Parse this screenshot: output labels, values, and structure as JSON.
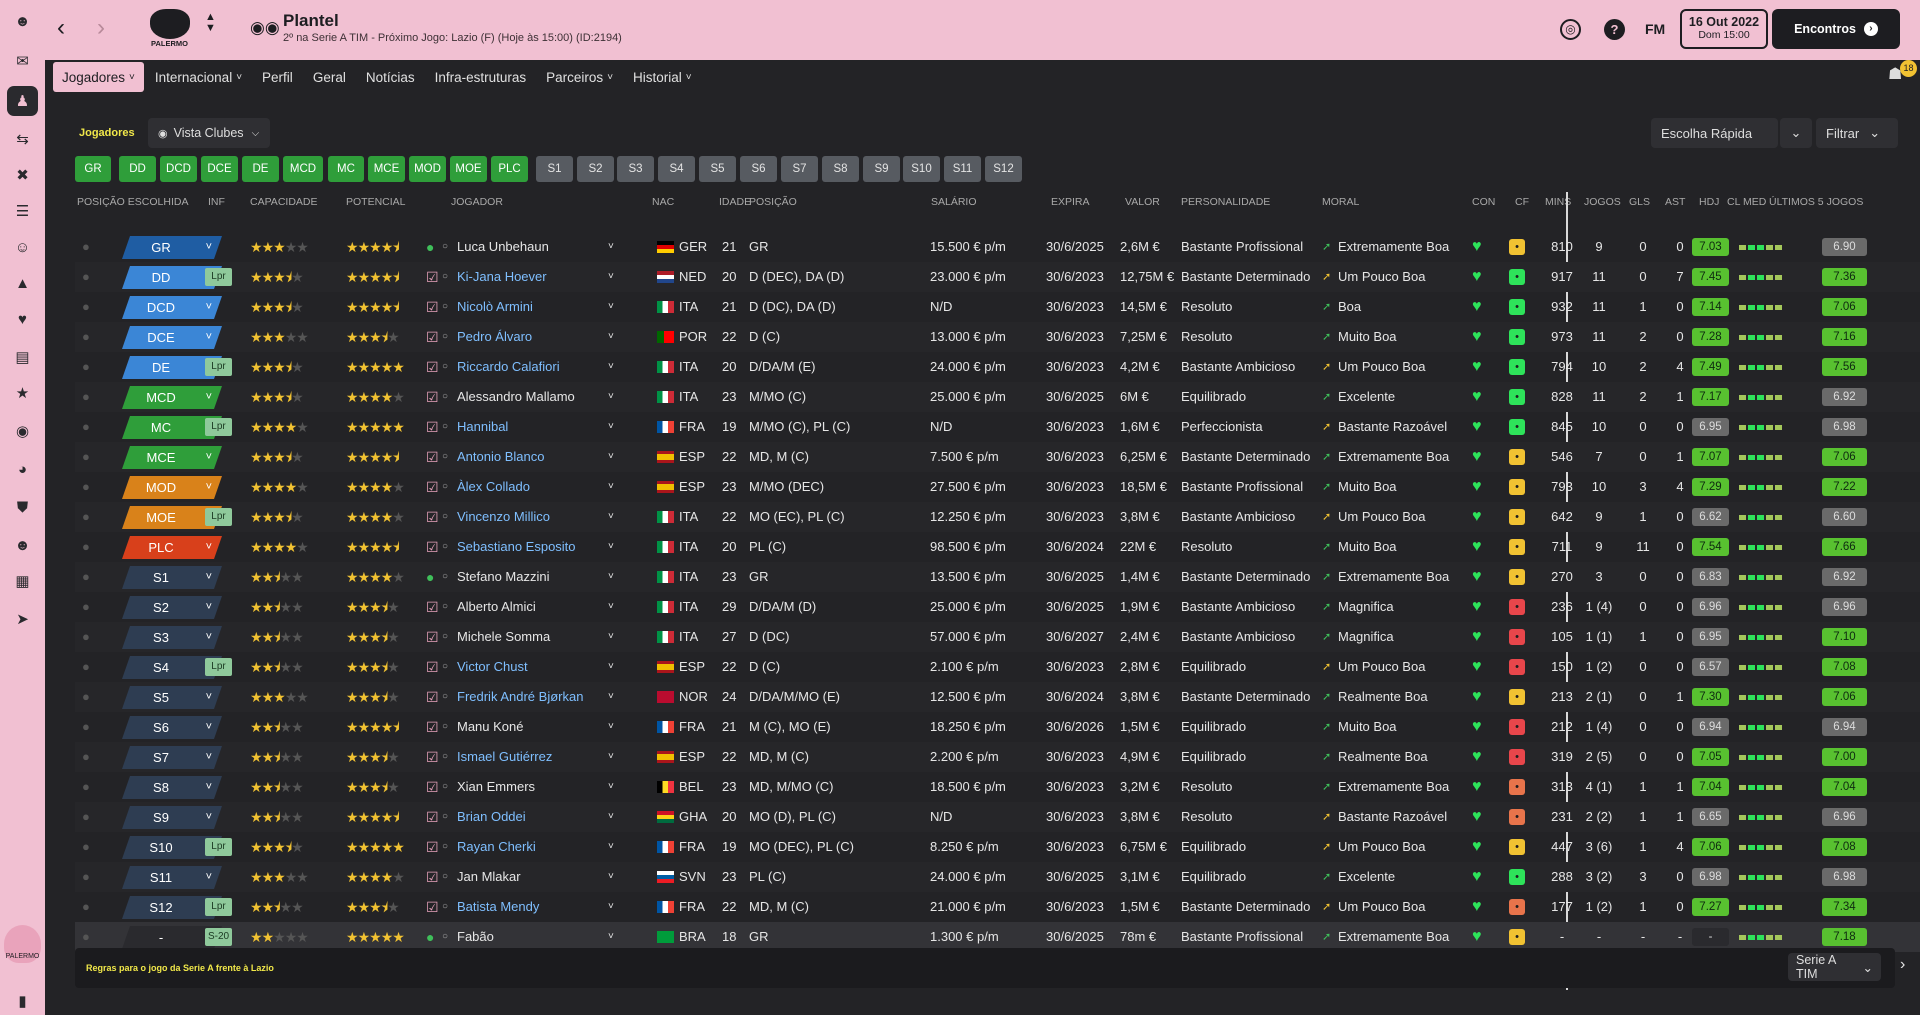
{
  "header": {
    "title": "Plantel",
    "subtitle": "2º na Serie A TIM - Próximo Jogo: Lazio (F) (Hoje às 15:00) (ID:2194)",
    "club": "PALERMO",
    "date": "16 Out 2022",
    "time": "Dom 15:00",
    "continue_label": "Encontros",
    "fm": "FM",
    "notif_count": "18"
  },
  "tabs": [
    {
      "label": "Jogadores",
      "active": true,
      "dd": true
    },
    {
      "label": "Internacional",
      "dd": true
    },
    {
      "label": "Perfil"
    },
    {
      "label": "Geral"
    },
    {
      "label": "Notícias"
    },
    {
      "label": "Infra-estruturas"
    },
    {
      "label": "Parceiros",
      "dd": true
    },
    {
      "label": "Historial",
      "dd": true
    }
  ],
  "toolbar": {
    "section": "Jogadores",
    "view": "Vista Clubes",
    "quick": "Escolha Rápida",
    "filter": "Filtrar"
  },
  "chips": [
    "GR",
    "DD",
    "DCD",
    "DCE",
    "DE",
    "MCD",
    "MC",
    "MCE",
    "MOD",
    "MOE",
    "PLC",
    "S1",
    "S2",
    "S3",
    "S4",
    "S5",
    "S6",
    "S7",
    "S8",
    "S9",
    "S10",
    "S11",
    "S12"
  ],
  "columns": {
    "pos": "POSIÇÃO ESCOLHIDA",
    "inf": "INF",
    "cap": "CAPACIDADE",
    "pot": "POTENCIAL",
    "jog": "JOGADOR",
    "nac": "NAC",
    "idade": "IDADE",
    "posicao": "POSIÇÃO",
    "sal": "SALÁRIO",
    "exp": "EXPIRA",
    "val": "VALOR",
    "pers": "PERSONALIDADE",
    "mor": "MORAL",
    "con": "CON",
    "cf": "CF",
    "mins": "MINS",
    "jogos": "JOGOS",
    "gls": "GLS",
    "ast": "AST",
    "hdj": "HDJ",
    "clm": "CL MED",
    "ult": "ÚLTIMOS 5 JOGOS"
  },
  "players": [
    {
      "pos": "GR",
      "pc": "#1f5da3",
      "inf": "",
      "cap": 3,
      "pot": 4.5,
      "name": "Luca Unbehaun",
      "link": false,
      "gk": true,
      "nat": "GER",
      "age": "21",
      "posi": "GR",
      "sal": "15.500 € p/m",
      "exp": "30/6/2025",
      "val": "2,6M €",
      "pers": "Bastante Profissional",
      "mor": "Extremamente Boa",
      "cf": "#f1c232",
      "mins": "810",
      "jogos": "9",
      "gls": "0",
      "ast": "0",
      "hdj": "0",
      "clm": "7.03",
      "ult": "6.90"
    },
    {
      "pos": "DD",
      "pc": "#3b86d6",
      "inf": "Lpr",
      "cap": 3.5,
      "pot": 4.5,
      "name": "Ki-Jana Hoever",
      "link": true,
      "nat": "NED",
      "age": "20",
      "posi": "D (DEC), DA (D)",
      "sal": "23.000 € p/m",
      "exp": "30/6/2023",
      "val": "12,75M €",
      "pers": "Bastante Determinado",
      "mor": "Um Pouco Boa",
      "cf": "#2ee35a",
      "mins": "917",
      "jogos": "11",
      "gls": "0",
      "ast": "7",
      "hdj": "1",
      "clm": "7.45",
      "ult": "7.36"
    },
    {
      "pos": "DCD",
      "pc": "#3b86d6",
      "inf": "",
      "cap": 3.5,
      "pot": 4.5,
      "name": "Nicolò Armini",
      "link": true,
      "nat": "ITA",
      "age": "21",
      "posi": "D (DC), DA (D)",
      "sal": "N/D",
      "exp": "30/6/2023",
      "val": "14,5M €",
      "pers": "Resoluto",
      "mor": "Boa",
      "cf": "#2ee35a",
      "mins": "932",
      "jogos": "11",
      "gls": "1",
      "ast": "0",
      "hdj": "0",
      "clm": "7.14",
      "ult": "7.06"
    },
    {
      "pos": "DCE",
      "pc": "#3b86d6",
      "inf": "",
      "cap": 3,
      "pot": 3.5,
      "name": "Pedro Álvaro",
      "link": true,
      "nat": "POR",
      "age": "22",
      "posi": "D (C)",
      "sal": "13.000 € p/m",
      "exp": "30/6/2023",
      "val": "7,25M €",
      "pers": "Resoluto",
      "mor": "Muito Boa",
      "cf": "#2ee35a",
      "mins": "973",
      "jogos": "11",
      "gls": "2",
      "ast": "0",
      "hdj": "0",
      "clm": "7.28",
      "ult": "7.16"
    },
    {
      "pos": "DE",
      "pc": "#3b86d6",
      "inf": "Lpr",
      "cap": 3.5,
      "pot": 5,
      "name": "Riccardo Calafiori",
      "link": true,
      "nat": "ITA",
      "age": "20",
      "posi": "D/DA/M (E)",
      "sal": "24.000 € p/m",
      "exp": "30/6/2023",
      "val": "4,2M €",
      "pers": "Bastante Ambicioso",
      "mor": "Um Pouco Boa",
      "cf": "#2ee35a",
      "mins": "794",
      "jogos": "10",
      "gls": "2",
      "ast": "4",
      "hdj": "2",
      "clm": "7.49",
      "ult": "7.56"
    },
    {
      "pos": "MCD",
      "pc": "#2f9e3a",
      "inf": "",
      "cap": 3.5,
      "pot": 4,
      "name": "Alessandro Mallamo",
      "link": false,
      "nat": "ITA",
      "age": "23",
      "posi": "M/MO (C)",
      "sal": "25.000 € p/m",
      "exp": "30/6/2025",
      "val": "6M €",
      "pers": "Equilibrado",
      "mor": "Excelente",
      "cf": "#2ee35a",
      "mins": "828",
      "jogos": "11",
      "gls": "2",
      "ast": "1",
      "hdj": "1",
      "clm": "7.17",
      "ult": "6.92"
    },
    {
      "pos": "MC",
      "pc": "#2f9e3a",
      "inf": "Lpr",
      "cap": 4,
      "pot": 5,
      "name": "Hannibal",
      "link": true,
      "nat": "FRA",
      "age": "19",
      "posi": "M/MO (C), PL (C)",
      "sal": "N/D",
      "exp": "30/6/2023",
      "val": "1,6M €",
      "pers": "Perfeccionista",
      "mor": "Bastante Razoável",
      "cf": "#2ee35a",
      "mins": "845",
      "jogos": "10",
      "gls": "0",
      "ast": "0",
      "hdj": "0",
      "clm": "6.95",
      "ult": "6.98"
    },
    {
      "pos": "MCE",
      "pc": "#2f9e3a",
      "inf": "",
      "cap": 3.5,
      "pot": 4.5,
      "name": "Antonio Blanco",
      "link": true,
      "nat": "ESP",
      "age": "22",
      "posi": "MD, M (C)",
      "sal": "7.500 € p/m",
      "exp": "30/6/2023",
      "val": "6,25M €",
      "pers": "Bastante Determinado",
      "mor": "Extremamente Boa",
      "cf": "#f1c232",
      "mins": "546",
      "jogos": "7",
      "gls": "0",
      "ast": "1",
      "hdj": "0",
      "clm": "7.07",
      "ult": "7.06"
    },
    {
      "pos": "MOD",
      "pc": "#d9821a",
      "inf": "",
      "cap": 4,
      "pot": 4,
      "name": "Àlex Collado",
      "link": true,
      "nat": "ESP",
      "age": "23",
      "posi": "M/MO (DEC)",
      "sal": "27.500 € p/m",
      "exp": "30/6/2023",
      "val": "18,5M €",
      "pers": "Bastante Profissional",
      "mor": "Muito Boa",
      "cf": "#f1c232",
      "mins": "793",
      "jogos": "10",
      "gls": "3",
      "ast": "4",
      "hdj": "2",
      "clm": "7.29",
      "ult": "7.22"
    },
    {
      "pos": "MOE",
      "pc": "#d9821a",
      "inf": "Lpr",
      "cap": 3.5,
      "pot": 4,
      "name": "Vincenzo Millico",
      "link": true,
      "nat": "ITA",
      "age": "22",
      "posi": "MO (EC), PL (C)",
      "sal": "12.250 € p/m",
      "exp": "30/6/2023",
      "val": "3,8M €",
      "pers": "Bastante Ambicioso",
      "mor": "Um Pouco Boa",
      "cf": "#f1c232",
      "mins": "642",
      "jogos": "9",
      "gls": "1",
      "ast": "0",
      "hdj": "0",
      "clm": "6.62",
      "ult": "6.60"
    },
    {
      "pos": "PLC",
      "pc": "#d8401b",
      "inf": "",
      "cap": 4,
      "pot": 4.5,
      "name": "Sebastiano Esposito",
      "link": true,
      "nat": "ITA",
      "age": "20",
      "posi": "PL (C)",
      "sal": "98.500 € p/m",
      "exp": "30/6/2024",
      "val": "22M €",
      "pers": "Resoluto",
      "mor": "Muito Boa",
      "cf": "#f1c232",
      "mins": "711",
      "jogos": "9",
      "gls": "11",
      "ast": "0",
      "hdj": "1",
      "clm": "7.54",
      "ult": "7.66"
    },
    {
      "pos": "S1",
      "pc": "#2e3d52",
      "inf": "",
      "cap": 2.5,
      "pot": 4,
      "name": "Stefano Mazzini",
      "link": false,
      "gk": true,
      "nat": "ITA",
      "age": "23",
      "posi": "GR",
      "sal": "13.500 € p/m",
      "exp": "30/6/2025",
      "val": "1,4M €",
      "pers": "Bastante Determinado",
      "mor": "Extremamente Boa",
      "cf": "#f1c232",
      "mins": "270",
      "jogos": "3",
      "gls": "0",
      "ast": "0",
      "hdj": "0",
      "clm": "6.83",
      "ult": "6.92"
    },
    {
      "pos": "S2",
      "pc": "#2e3d52",
      "inf": "",
      "cap": 2.5,
      "pot": 3.5,
      "name": "Alberto Almici",
      "link": false,
      "nat": "ITA",
      "age": "29",
      "posi": "D/DA/M (D)",
      "sal": "25.000 € p/m",
      "exp": "30/6/2025",
      "val": "1,9M €",
      "pers": "Bastante Ambicioso",
      "mor": "Magnifica",
      "cf": "#e8464b",
      "mins": "236",
      "jogos": "1 (4)",
      "gls": "0",
      "ast": "0",
      "hdj": "0",
      "clm": "6.96",
      "ult": "6.96"
    },
    {
      "pos": "S3",
      "pc": "#2e3d52",
      "inf": "",
      "cap": 2.5,
      "pot": 3.5,
      "name": "Michele Somma",
      "link": false,
      "nat": "ITA",
      "age": "27",
      "posi": "D (DC)",
      "sal": "57.000 € p/m",
      "exp": "30/6/2027",
      "val": "2,4M €",
      "pers": "Bastante Ambicioso",
      "mor": "Magnifica",
      "cf": "#e8464b",
      "mins": "105",
      "jogos": "1 (1)",
      "gls": "1",
      "ast": "0",
      "hdj": "0",
      "clm": "6.95",
      "ult": "7.10"
    },
    {
      "pos": "S4",
      "pc": "#2e3d52",
      "inf": "Lpr",
      "cap": 2.5,
      "pot": 3.5,
      "name": "Victor Chust",
      "link": true,
      "nat": "ESP",
      "age": "22",
      "posi": "D (C)",
      "sal": "2.100 € p/m",
      "exp": "30/6/2023",
      "val": "2,8M €",
      "pers": "Equilibrado",
      "mor": "Um Pouco Boa",
      "cf": "#e8464b",
      "mins": "150",
      "jogos": "1 (2)",
      "gls": "0",
      "ast": "0",
      "hdj": "0",
      "clm": "6.57",
      "ult": "7.08"
    },
    {
      "pos": "S5",
      "pc": "#2e3d52",
      "inf": "",
      "cap": 3,
      "pot": 3.5,
      "name": "Fredrik André Bjørkan",
      "link": true,
      "nat": "NOR",
      "age": "24",
      "posi": "D/DA/M/MO (E)",
      "sal": "12.500 € p/m",
      "exp": "30/6/2024",
      "val": "3,8M €",
      "pers": "Bastante Determinado",
      "mor": "Realmente Boa",
      "cf": "#f1c232",
      "mins": "213",
      "jogos": "2 (1)",
      "gls": "0",
      "ast": "1",
      "hdj": "1",
      "clm": "7.30",
      "ult": "7.06"
    },
    {
      "pos": "S6",
      "pc": "#2e3d52",
      "inf": "",
      "cap": 2.5,
      "pot": 4.5,
      "name": "Manu Koné",
      "link": false,
      "nat": "FRA",
      "age": "21",
      "posi": "M (C), MO (E)",
      "sal": "18.250 € p/m",
      "exp": "30/6/2026",
      "val": "1,5M €",
      "pers": "Equilibrado",
      "mor": "Muito Boa",
      "cf": "#e8464b",
      "mins": "212",
      "jogos": "1 (4)",
      "gls": "0",
      "ast": "0",
      "hdj": "0",
      "clm": "6.94",
      "ult": "6.94"
    },
    {
      "pos": "S7",
      "pc": "#2e3d52",
      "inf": "",
      "cap": 2.5,
      "pot": 3.5,
      "name": "Ismael Gutiérrez",
      "link": true,
      "nat": "ESP",
      "age": "22",
      "posi": "MD, M (C)",
      "sal": "2.200 € p/m",
      "exp": "30/6/2023",
      "val": "4,9M €",
      "pers": "Equilibrado",
      "mor": "Realmente Boa",
      "cf": "#e8464b",
      "mins": "319",
      "jogos": "2 (5)",
      "gls": "0",
      "ast": "0",
      "hdj": "0",
      "clm": "7.05",
      "ult": "7.00"
    },
    {
      "pos": "S8",
      "pc": "#2e3d52",
      "inf": "",
      "cap": 2.5,
      "pot": 3.5,
      "name": "Xian Emmers",
      "link": false,
      "nat": "BEL",
      "age": "23",
      "posi": "MD, M/MO (C)",
      "sal": "18.500 € p/m",
      "exp": "30/6/2023",
      "val": "3,2M €",
      "pers": "Resoluto",
      "mor": "Extremamente Boa",
      "cf": "#e8744b",
      "mins": "313",
      "jogos": "4 (1)",
      "gls": "1",
      "ast": "1",
      "hdj": "0",
      "clm": "7.04",
      "ult": "7.04"
    },
    {
      "pos": "S9",
      "pc": "#2e3d52",
      "inf": "",
      "cap": 2.5,
      "pot": 4.5,
      "name": "Brian Oddei",
      "link": true,
      "nat": "GHA",
      "age": "20",
      "posi": "MO (D), PL (C)",
      "sal": "N/D",
      "exp": "30/6/2023",
      "val": "3,8M €",
      "pers": "Resoluto",
      "mor": "Bastante Razoável",
      "cf": "#e8744b",
      "mins": "231",
      "jogos": "2 (2)",
      "gls": "1",
      "ast": "1",
      "hdj": "0",
      "clm": "6.65",
      "ult": "6.96"
    },
    {
      "pos": "S10",
      "pc": "#2e3d52",
      "inf": "Lpr",
      "cap": 3.5,
      "pot": 5,
      "name": "Rayan Cherki",
      "link": true,
      "nat": "FRA",
      "age": "19",
      "posi": "MO (DEC), PL (C)",
      "sal": "8.250 € p/m",
      "exp": "30/6/2023",
      "val": "6,75M €",
      "pers": "Equilibrado",
      "mor": "Um Pouco Boa",
      "cf": "#f1c232",
      "mins": "447",
      "jogos": "3 (6)",
      "gls": "1",
      "ast": "4",
      "hdj": "1",
      "clm": "7.06",
      "ult": "7.08"
    },
    {
      "pos": "S11",
      "pc": "#2e3d52",
      "inf": "",
      "cap": 3,
      "pot": 4,
      "name": "Jan Mlakar",
      "link": false,
      "nat": "SVN",
      "age": "23",
      "posi": "PL (C)",
      "sal": "24.000 € p/m",
      "exp": "30/6/2025",
      "val": "3,1M €",
      "pers": "Equilibrado",
      "mor": "Excelente",
      "cf": "#2ee35a",
      "mins": "288",
      "jogos": "3 (2)",
      "gls": "3",
      "ast": "0",
      "hdj": "0",
      "clm": "6.98",
      "ult": "6.98"
    },
    {
      "pos": "S12",
      "pc": "#2e3d52",
      "inf": "Lpr",
      "cap": 2.5,
      "pot": 3.5,
      "name": "Batista Mendy",
      "link": true,
      "nat": "FRA",
      "age": "22",
      "posi": "MD, M (C)",
      "sal": "21.000 € p/m",
      "exp": "30/6/2023",
      "val": "1,5M €",
      "pers": "Bastante Determinado",
      "mor": "Um Pouco Boa",
      "cf": "#e8744b",
      "mins": "177",
      "jogos": "1 (2)",
      "gls": "1",
      "ast": "0",
      "hdj": "1",
      "clm": "7.27",
      "ult": "7.34"
    },
    {
      "pos": "-",
      "pc": "#2a2a2e",
      "inf": "S-20",
      "cap": 2,
      "pot": 5,
      "name": "Fabão",
      "link": false,
      "gk": true,
      "nat": "BRA",
      "age": "18",
      "posi": "GR",
      "sal": "1.300 € p/m",
      "exp": "30/6/2025",
      "val": "78m €",
      "pers": "Bastante Profissional",
      "mor": "Extremamente Boa",
      "cf": "#f1c232",
      "mins": "-",
      "jogos": "-",
      "gls": "-",
      "ast": "-",
      "hdj": "-",
      "clm": "-",
      "ult": "7.18"
    }
  ],
  "footer": {
    "rules": "Regras para o jogo da Serie A frente à Lazio",
    "competition": "Serie A TIM"
  }
}
